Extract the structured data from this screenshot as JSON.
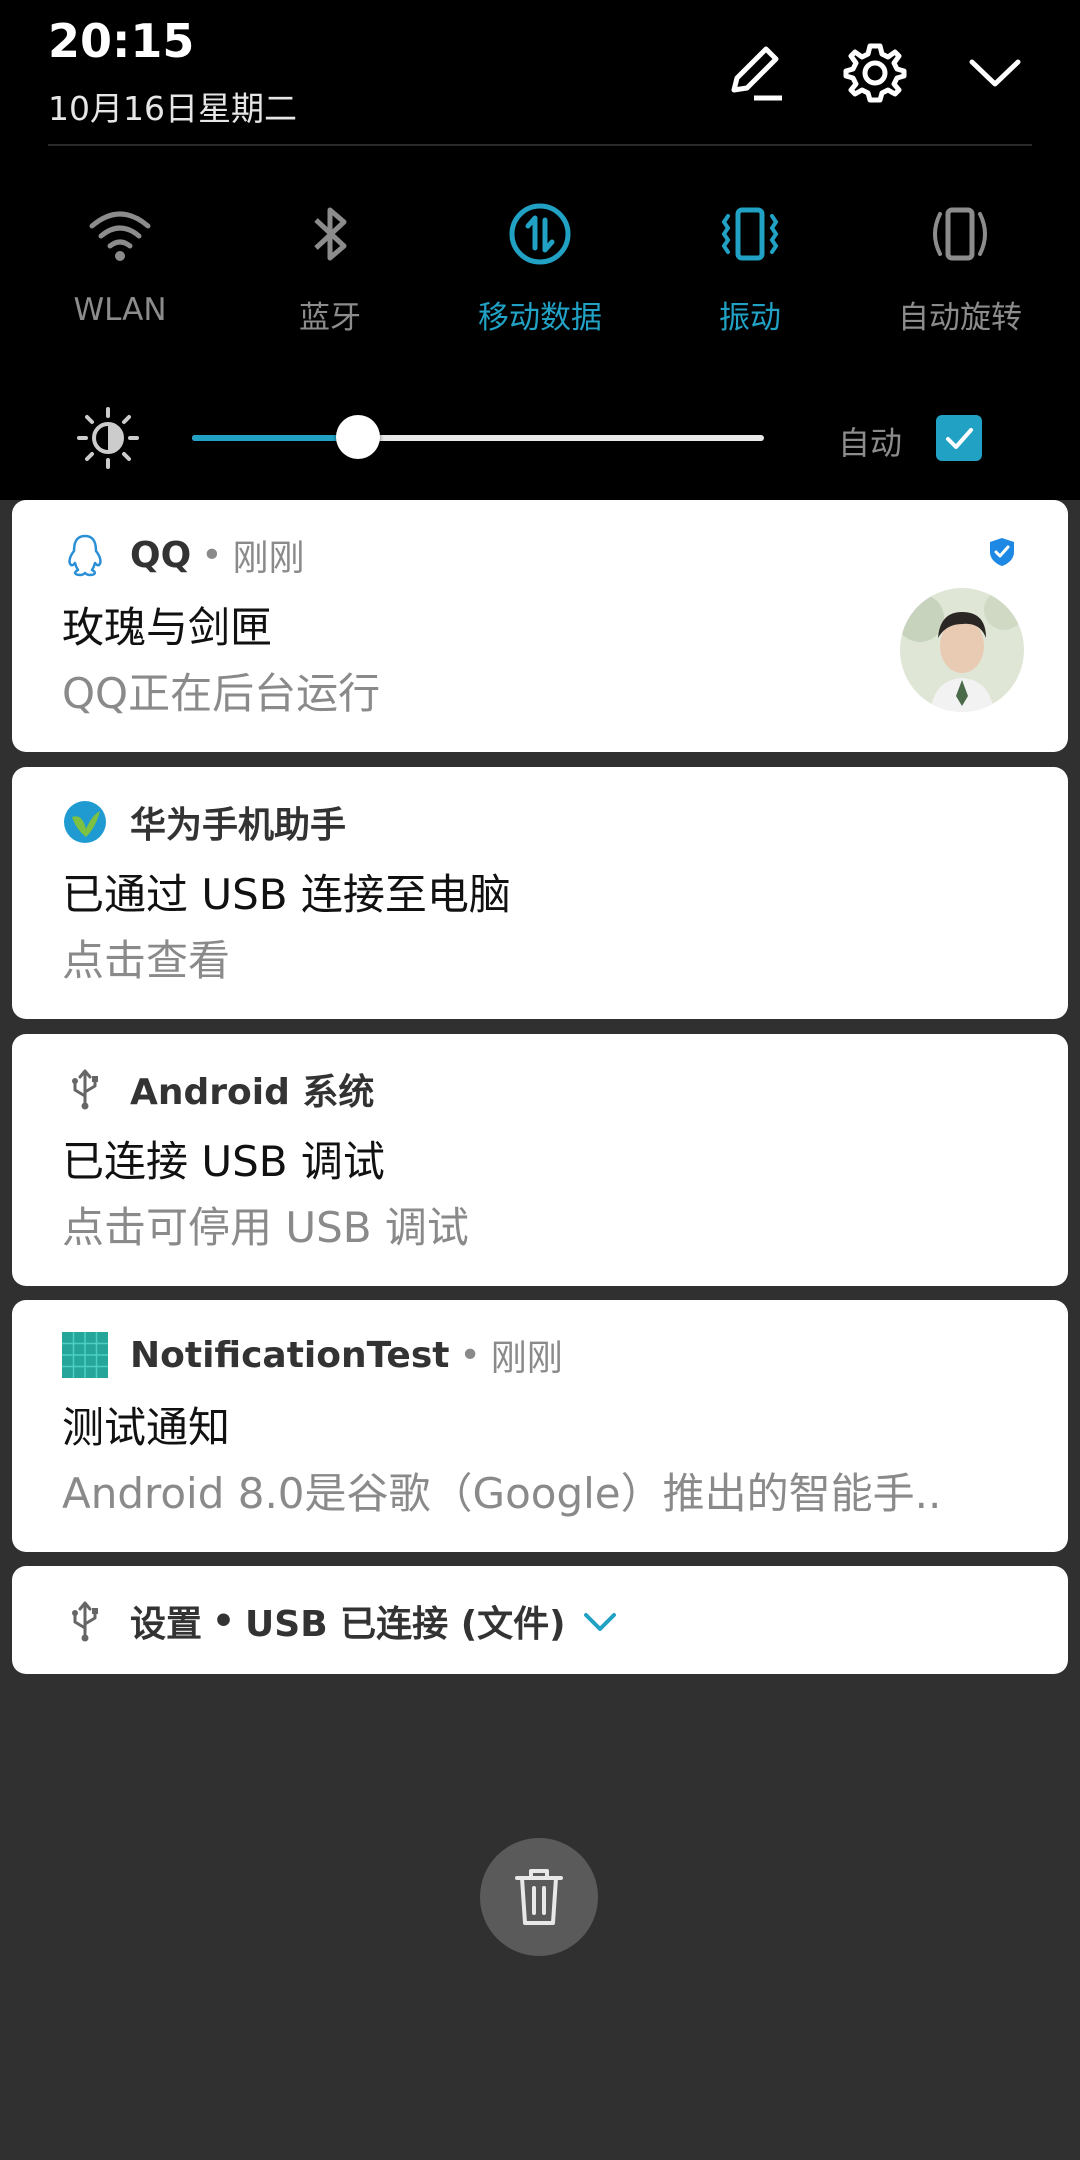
{
  "status": {
    "time": "20:15",
    "date": "10月16日星期二"
  },
  "header_icons": [
    "edit-icon",
    "settings-gear-icon",
    "collapse-chevron-icon"
  ],
  "quick_settings": [
    {
      "label": "WLAN",
      "icon": "wifi-icon",
      "active": false
    },
    {
      "label": "蓝牙",
      "icon": "bluetooth-icon",
      "active": false
    },
    {
      "label": "移动数据",
      "icon": "mobile-data-icon",
      "active": true
    },
    {
      "label": "振动",
      "icon": "vibrate-icon",
      "active": true
    },
    {
      "label": "自动旋转",
      "icon": "auto-rotate-icon",
      "active": false
    }
  ],
  "brightness": {
    "level_fraction": 0.29,
    "auto_label": "自动",
    "auto_checked": true
  },
  "colors": {
    "accent": "#21a1c4",
    "shade_bg": "#000000",
    "panel_bg": "#303030",
    "card_bg": "#ffffff"
  },
  "notifications": [
    {
      "app": "QQ",
      "separator": "•",
      "time": "刚刚",
      "title": "玫瑰与剑匣",
      "body": "QQ正在后台运行",
      "icon": "qq-penguin-icon",
      "has_avatar": true,
      "verified_badge": true
    },
    {
      "app": "华为手机助手",
      "title": "已通过 USB 连接至电脑",
      "body": "点击查看",
      "icon": "huawei-assistant-icon"
    },
    {
      "app": "Android 系统",
      "title": "已连接 USB 调试",
      "body": "点击可停用 USB 调试",
      "icon": "usb-icon"
    },
    {
      "app": "NotificationTest",
      "separator": "•",
      "time": "刚刚",
      "title": "测试通知",
      "body": "Android 8.0是谷歌（Google）推出的智能手..",
      "icon": "notification-test-app-icon"
    },
    {
      "app": "设置",
      "separator": "•",
      "summary": "USB 已连接 (文件)",
      "icon": "usb-icon",
      "expandable": true
    }
  ],
  "clear_all_icon": "trash-icon"
}
